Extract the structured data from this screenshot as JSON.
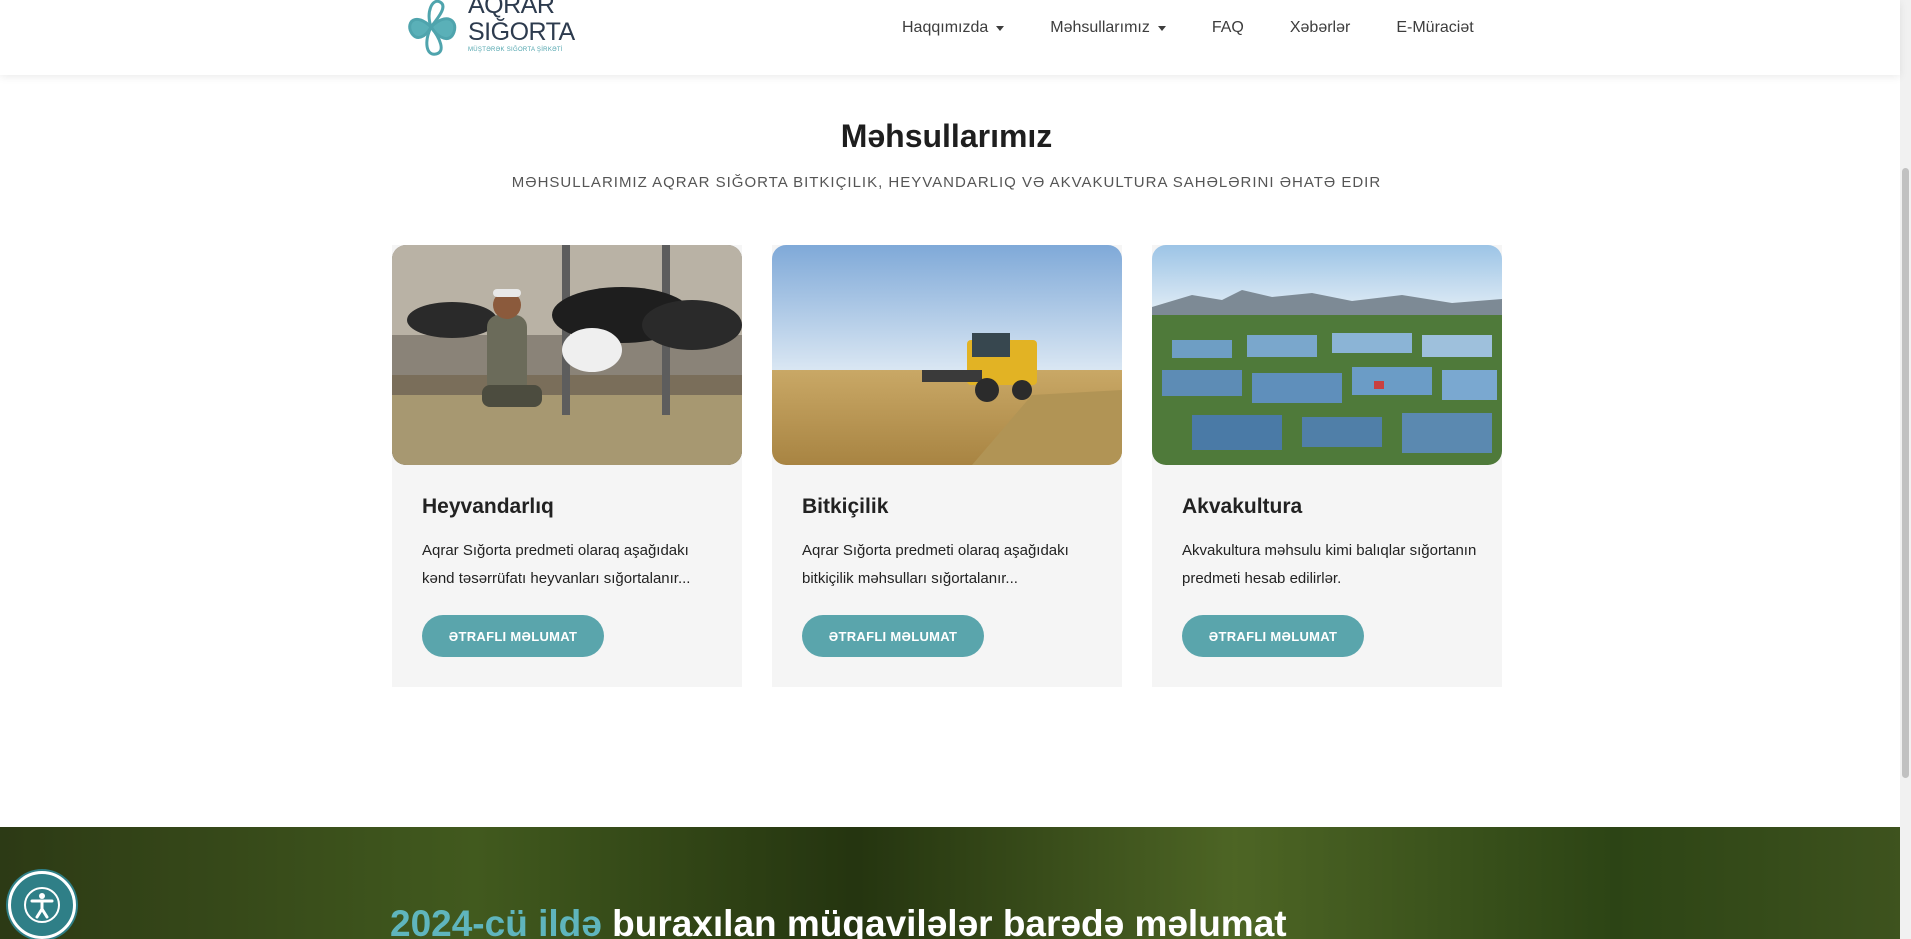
{
  "header": {
    "logo_line1": "AQRAR",
    "logo_line2": "SIĞORTA",
    "logo_sub": "MÜŞTƏRƏK SIĞORTA ŞİRKƏTİ",
    "nav": [
      {
        "label": "Haqqımızda",
        "dropdown": true
      },
      {
        "label": "Məhsullarımız",
        "dropdown": true
      },
      {
        "label": "FAQ",
        "dropdown": false
      },
      {
        "label": "Xəbərlər",
        "dropdown": false
      },
      {
        "label": "E-Müraciət",
        "dropdown": false
      }
    ]
  },
  "products": {
    "title": "Məhsullarımız",
    "subtitle": "MƏHSULLARIMIZ AQRAR SIĞORTA BITKIÇILIK, HEYVANDARLIQ VƏ AKVAKULTURA SAHƏLƏRINI ƏHATƏ EDIR",
    "cards": [
      {
        "title": "Heyvandarlıq",
        "desc": "Aqrar Sığorta predmeti olaraq aşağıdakı kənd təsərrüfatı heyvanları sığortalanır...",
        "button": "ƏTRAFLI MƏLUMAT",
        "image": "farmer-with-cows-photo"
      },
      {
        "title": "Bitkiçilik",
        "desc": "Aqrar Sığorta predmeti olaraq aşağıdakı bitkiçilik məhsulları sığortalanır...",
        "button": "ƏTRAFLI MƏLUMAT",
        "image": "combine-harvester-photo"
      },
      {
        "title": "Akvakultura",
        "desc": "Akvakultura məhsulu kimi balıqlar sığortanın predmeti hesab edilirlər.",
        "button": "ƏTRAFLI MƏLUMAT",
        "image": "fish-ponds-aerial-photo"
      }
    ]
  },
  "banner": {
    "accent": "2024-cü ildə",
    "rest": " buraxılan müqavilələr barədə məlumat"
  },
  "colors": {
    "accent": "#5aa5ac",
    "title_text": "#1e1e1e"
  },
  "icons": {
    "accessibility": "accessibility-icon"
  }
}
